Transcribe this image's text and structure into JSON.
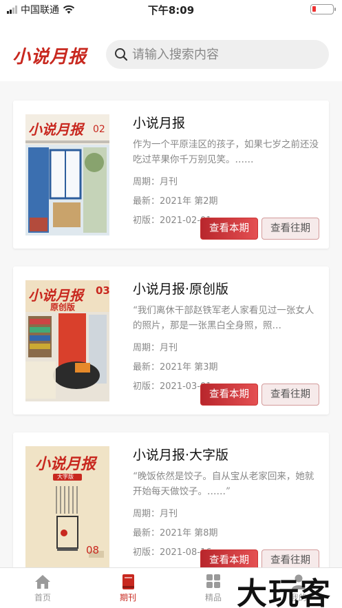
{
  "status_bar": {
    "carrier": "中国联通",
    "time": "下午8:09"
  },
  "header": {
    "logo_text": "小说月报",
    "search_placeholder": "请输入搜索内容"
  },
  "magazines": [
    {
      "title": "小说月报",
      "description": "作为一个平原洼区的孩子，如果七岁之前还没吃过苹果你千万别见笑。……",
      "period": "周期：月刊",
      "latest": "最新：2021年 第2期",
      "first_edition": "初版：2021-02-01",
      "cover_logo": "小说月报",
      "cover_issue": "02",
      "cover_subtitle": "",
      "view_current": "查看本期",
      "view_past": "查看往期"
    },
    {
      "title": "小说月报·原创版",
      "description": "“我们离休干部赵铁军老人家看见过一张女人的照片，那是一张黑白全身照，照…",
      "period": "周期：月刊",
      "latest": "最新：2021年 第3期",
      "first_edition": "初版：2021-03-01",
      "cover_logo": "小说月报",
      "cover_issue": "03",
      "cover_subtitle": "原创版",
      "view_current": "查看本期",
      "view_past": "查看往期"
    },
    {
      "title": "小说月报·大字版",
      "description": "“晚饭依然是饺子。自从宝从老家回来，她就开始每天做饺子。……”",
      "period": "周期：月刊",
      "latest": "最新：2021年 第8期",
      "first_edition": "初版：2021-08-16",
      "cover_logo": "小说月报",
      "cover_issue": "08",
      "cover_subtitle": "大字版",
      "view_current": "查看本期",
      "view_past": "查看往期"
    }
  ],
  "tab_bar": {
    "tabs": [
      {
        "label": "首页",
        "icon": "home-icon"
      },
      {
        "label": "期刊",
        "icon": "book-icon"
      },
      {
        "label": "精品",
        "icon": "grid-icon"
      },
      {
        "label": "我的",
        "icon": "person-icon"
      }
    ],
    "active_tab": "期刊"
  },
  "watermark_text": "大玩客",
  "colors": {
    "brand": "#c8281f",
    "button_current": "#d9373d",
    "button_past_bg": "#f6eaea"
  }
}
